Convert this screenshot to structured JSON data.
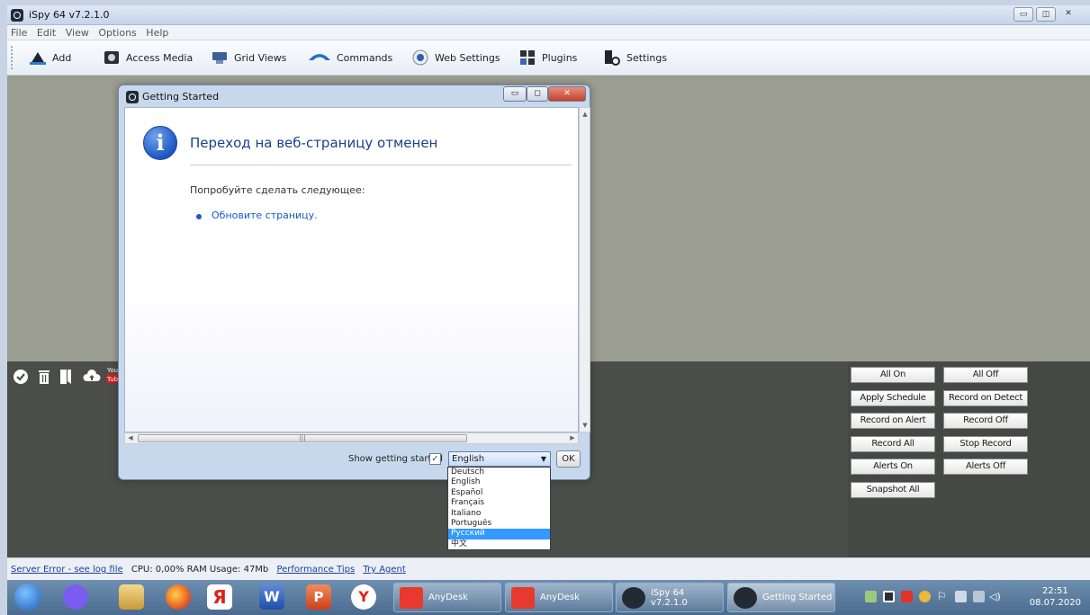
{
  "window": {
    "title": "iSpy 64 v7.2.1.0"
  },
  "menu": [
    "File",
    "Edit",
    "View",
    "Options",
    "Help"
  ],
  "toolbar": [
    {
      "label": "Add",
      "icon": "add-icon"
    },
    {
      "label": "Access Media",
      "icon": "media-icon"
    },
    {
      "label": "Grid Views",
      "icon": "grid-views-icon"
    },
    {
      "label": "Commands",
      "icon": "commands-icon"
    },
    {
      "label": "Web Settings",
      "icon": "web-settings-icon"
    },
    {
      "label": "Plugins",
      "icon": "plugins-icon"
    },
    {
      "label": "Settings",
      "icon": "settings-icon"
    }
  ],
  "dialog": {
    "title": "Getting Started",
    "heading": "Переход на веб-страницу отменен",
    "subheading": "Попробуйте сделать следующее:",
    "link": "Обновите страницу.",
    "show_label": "Show getting started",
    "show_checked": "✓",
    "language_selected": "English",
    "ok": "OK",
    "languages": [
      "Deutsch",
      "English",
      "Español",
      "Français",
      "Italiano",
      "Português",
      "Русский",
      "中文"
    ],
    "highlighted_language": "Русский"
  },
  "commands": [
    "All On",
    "All Off",
    "Apply Schedule",
    "Record on Detect",
    "Record on Alert",
    "Record Off",
    "Record All",
    "Stop Record",
    "Alerts On",
    "Alerts Off",
    "Snapshot All"
  ],
  "status": {
    "server_error": "Server Error - see log file",
    "usage": "CPU: 0,00% RAM Usage: 47Mb",
    "perf_tips": "Performance Tips",
    "try_agent": "Try Agent"
  },
  "taskbar": {
    "buttons": [
      "AnyDesk",
      "AnyDesk",
      "iSpy 64 v7.2.1.0",
      "Getting Started"
    ],
    "time": "22:51",
    "date": "08.07.2020"
  },
  "colors": {
    "workspace": "#9b9c92",
    "panel": "#4b4d48",
    "accent_blue": "#1b3f8f",
    "selection": "#3399ff"
  }
}
